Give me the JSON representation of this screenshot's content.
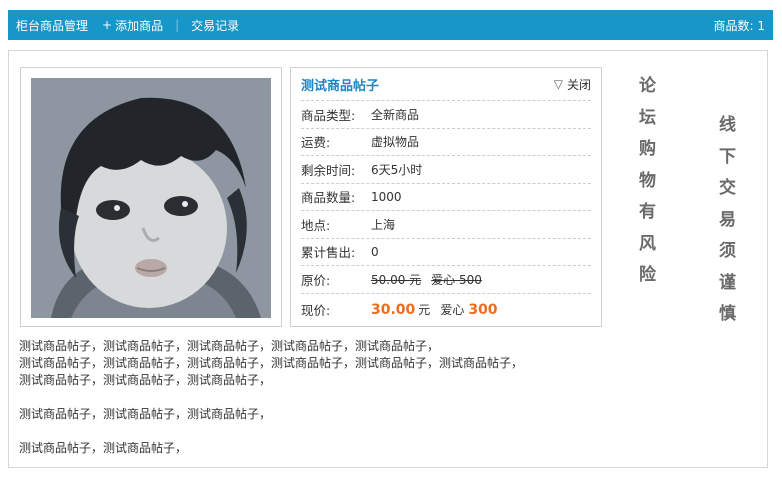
{
  "topbar": {
    "home": "柜台商品管理",
    "add_plus": "+",
    "add": "添加商品",
    "separator": "|",
    "records": "交易记录",
    "count": "商品数: 1"
  },
  "product": {
    "title": "测试商品帖子",
    "close_label": "关闭",
    "close_icon": "triangle-down-icon",
    "rows": {
      "type": {
        "label": "商品类型:",
        "value": "全新商品"
      },
      "ship": {
        "label": "运费:",
        "value": "虚拟物品"
      },
      "remain": {
        "label": "剩余时间:",
        "value": "6天5小时"
      },
      "qty": {
        "label": "商品数量:",
        "value": "1000"
      },
      "loc": {
        "label": "地点:",
        "value": "上海"
      },
      "sold": {
        "label": "累计售出:",
        "value": "0"
      },
      "orig": {
        "label": "原价:",
        "price": "50.00 元",
        "love": "爱心 500"
      },
      "now": {
        "label": "现价:",
        "price": "30.00",
        "unit": "元",
        "love_label": "爱心",
        "love": "300"
      }
    }
  },
  "warning_left": [
    "论",
    "坛",
    "购",
    "物",
    "有",
    "风",
    "险"
  ],
  "warning_right": [
    "线",
    "下",
    "交",
    "易",
    "须",
    "谨",
    "慎"
  ],
  "description": {
    "lines": [
      "测试商品帖子，测试商品帖子，测试商品帖子，测试商品帖子，测试商品帖子，",
      "测试商品帖子，测试商品帖子，测试商品帖子，测试商品帖子，测试商品帖子，测试商品帖子，",
      "测试商品帖子，测试商品帖子，测试商品帖子，",
      "",
      "测试商品帖子，测试商品帖子，测试商品帖子，",
      "",
      "测试商品帖子，测试商品帖子，"
    ]
  },
  "colors": {
    "topbar": "#1796c9",
    "title": "#1f86c0",
    "price": "#f06c1c"
  }
}
